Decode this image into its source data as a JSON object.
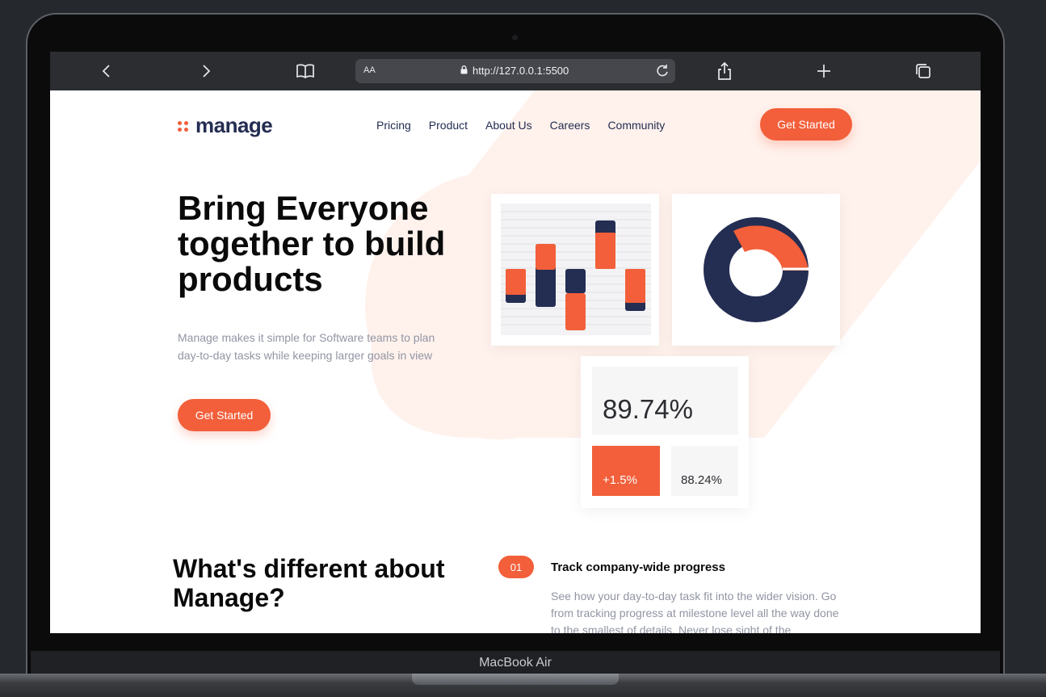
{
  "device": {
    "label": "MacBook Air"
  },
  "browser": {
    "text_size_label": "AA",
    "url": "http://127.0.0.1:5500",
    "icons": [
      "back-icon",
      "forward-icon",
      "bookmarks-icon",
      "lock-icon",
      "reload-icon",
      "share-icon",
      "new-tab-icon",
      "tabs-icon"
    ]
  },
  "site": {
    "logo": "manage",
    "nav": [
      "Pricing",
      "Product",
      "About Us",
      "Careers",
      "Community"
    ],
    "header_cta": "Get Started",
    "hero": {
      "title": "Bring Everyone together to build products",
      "description": "Manage makes it simple for Software teams to plan day-to-day tasks while keeping larger goals in view",
      "cta": "Get Started"
    },
    "stats": {
      "main": "89.74%",
      "delta": "+1.5%",
      "secondary": "88.24%"
    },
    "features_title": "What's different about Manage?",
    "feature": {
      "number": "01",
      "title": "Track company-wide progress",
      "description": "See how your day-to-day task fit into the wider vision. Go from tracking progress at milestone level all the way done to the smallest of details. Never lose sight of the"
    }
  },
  "colors": {
    "accent": "#f25f3a",
    "navy": "#242d52",
    "muted": "#9195a3",
    "tint": "#fff1ec"
  }
}
